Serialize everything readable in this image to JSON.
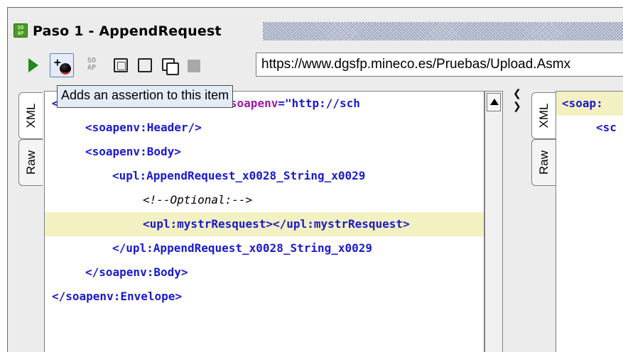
{
  "window": {
    "title": "Paso 1 - AppendRequest",
    "icon_label": "SO AP"
  },
  "toolbar": {
    "items": [
      {
        "name": "run-icon"
      },
      {
        "name": "add-assertion-icon"
      },
      {
        "name": "soap-icon",
        "label": "SO AP"
      },
      {
        "name": "resize-icon"
      },
      {
        "name": "square-icon"
      },
      {
        "name": "copy-icon"
      },
      {
        "name": "stop-icon"
      }
    ],
    "endpoint_url": "https://www.dgsfp.mineco.es/Pruebas/Upload.Asmx"
  },
  "tooltip": {
    "text": "Adds an assertion to this item"
  },
  "request_panel": {
    "tabs": [
      "XML",
      "Raw"
    ],
    "lines": [
      {
        "indent": 0,
        "text": "<soapenv:Envelope xmlns:soapenv=\"http://schemas.xmlsoap.org/soap/envelope/\">",
        "visible_text_left": "<",
        "visible_text_attr": "s:soapenv",
        "visible_text_rest": "=\"http://sch"
      },
      {
        "indent": 1,
        "text": "<soapenv:Header/>"
      },
      {
        "indent": 1,
        "text": "<soapenv:Body>"
      },
      {
        "indent": 2,
        "text": "<upl:AppendRequest_x0028_String_x0029"
      },
      {
        "indent": 3,
        "text": "<!--Optional:-->",
        "comment": true
      },
      {
        "indent": 3,
        "text": "<upl:mystrResquest></upl:mystrResquest>",
        "highlight": true
      },
      {
        "indent": 2,
        "text": "</upl:AppendRequest_x0028_String_x0029"
      },
      {
        "indent": 1,
        "text": "</soapenv:Body>"
      },
      {
        "indent": 0,
        "text": "</soapenv:Envelope>"
      }
    ]
  },
  "response_panel": {
    "tabs": [
      "XML",
      "Raw"
    ],
    "lines": [
      {
        "text": "<soap:"
      },
      {
        "text": "<sc"
      }
    ]
  },
  "colors": {
    "tag": "#1a1ad0",
    "namespace_attr": "#9b1aa8",
    "highlight": "#f3f1c2",
    "tooltip_bg": "#e3ebf7"
  }
}
